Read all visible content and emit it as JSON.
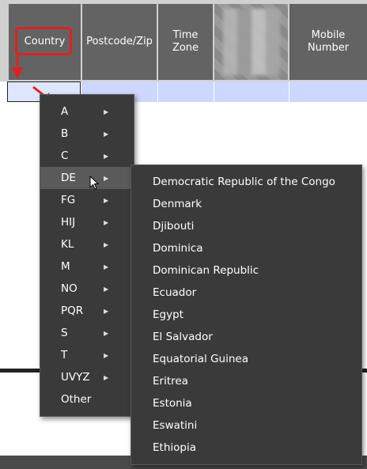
{
  "columns": [
    {
      "label": "Country"
    },
    {
      "label": "Postcode/Zip"
    },
    {
      "label": "Time\nZone"
    },
    {
      "label": ""
    },
    {
      "label": "Mobile\nNumber"
    }
  ],
  "country_menu": {
    "items": [
      {
        "label": "A",
        "has_submenu": true
      },
      {
        "label": "B",
        "has_submenu": true
      },
      {
        "label": "C",
        "has_submenu": true
      },
      {
        "label": "DE",
        "has_submenu": true
      },
      {
        "label": "FG",
        "has_submenu": true
      },
      {
        "label": "HIJ",
        "has_submenu": true
      },
      {
        "label": "KL",
        "has_submenu": true
      },
      {
        "label": "M",
        "has_submenu": true
      },
      {
        "label": "NO",
        "has_submenu": true
      },
      {
        "label": "PQR",
        "has_submenu": true
      },
      {
        "label": "S",
        "has_submenu": true
      },
      {
        "label": "T",
        "has_submenu": true
      },
      {
        "label": "UVYZ",
        "has_submenu": true
      },
      {
        "label": "Other",
        "has_submenu": false
      }
    ],
    "hovered": "DE"
  },
  "de_submenu": {
    "items": [
      "Democratic Republic of the Congo",
      "Denmark",
      "Djibouti",
      "Dominica",
      "Dominican Republic",
      "Ecuador",
      "Egypt",
      "El Salvador",
      "Equatorial Guinea",
      "Eritrea",
      "Estonia",
      "Eswatini",
      "Ethiopia"
    ]
  },
  "colors": {
    "header_bg": "#636363",
    "menu_bg": "#3a3a3a",
    "highlight": "#e02020",
    "row_bg": "#cdd7ff"
  }
}
